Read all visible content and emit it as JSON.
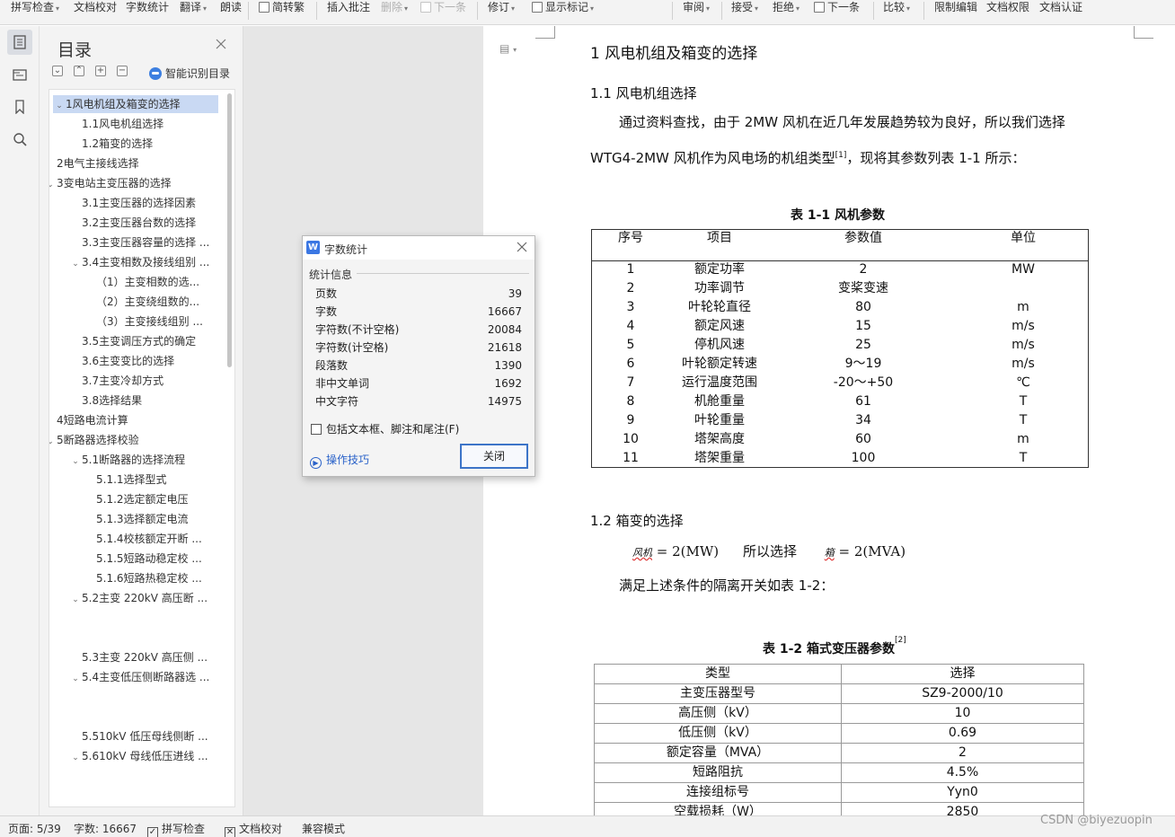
{
  "ribbon": [
    {
      "label": "拼写检查",
      "arrow": true,
      "disabled": false
    },
    {
      "label": "文档校对",
      "arrow": false,
      "disabled": false
    },
    {
      "label": "字数统计",
      "arrow": false,
      "disabled": false
    },
    {
      "label": "翻译",
      "arrow": true,
      "disabled": false
    },
    {
      "label": "朗读",
      "arrow": false,
      "disabled": false
    },
    {
      "label": "简转繁",
      "arrow": false,
      "disabled": false,
      "icon": true
    },
    {
      "label": "插入批注",
      "arrow": false,
      "disabled": false
    },
    {
      "label": "删除",
      "arrow": true,
      "disabled": true
    },
    {
      "label": "下一条",
      "arrow": false,
      "disabled": true,
      "icon": true
    },
    {
      "label": "修订",
      "arrow": true,
      "disabled": false
    },
    {
      "label": "显示标记",
      "arrow": true,
      "disabled": false,
      "icon": true
    },
    {
      "label": "审阅",
      "arrow": true,
      "disabled": false
    },
    {
      "label": "接受",
      "arrow": true,
      "disabled": false
    },
    {
      "label": "拒绝",
      "arrow": true,
      "disabled": false
    },
    {
      "label": "下一条",
      "arrow": false,
      "disabled": false,
      "icon": true
    },
    {
      "label": "比较",
      "arrow": true,
      "disabled": false
    },
    {
      "label": "限制编辑",
      "arrow": false,
      "disabled": false
    },
    {
      "label": "文档权限",
      "arrow": false,
      "disabled": false
    },
    {
      "label": "文档认证",
      "arrow": false,
      "disabled": false
    }
  ],
  "sidebar_icons": [
    "toc-icon",
    "outline-icon",
    "bookmark-icon",
    "search-icon"
  ],
  "toc": {
    "title": "目录",
    "smart_label": "智能识别目录",
    "items": [
      {
        "label": "1风电机组及箱变的选择",
        "indent": 0,
        "chev": "open",
        "selected": true
      },
      {
        "label": "1.1风电机组选择",
        "indent": 1,
        "chev": "",
        "selected": false
      },
      {
        "label": "1.2箱变的选择",
        "indent": 1,
        "chev": "",
        "selected": false
      },
      {
        "label": "2电气主接线选择",
        "indent": 0,
        "chev": "",
        "selected": false
      },
      {
        "label": "3变电站主变压器的选择",
        "indent": 0,
        "chev": "open",
        "selected": false
      },
      {
        "label": "3.1主变压器的选择因素",
        "indent": 1,
        "chev": "",
        "selected": false
      },
      {
        "label": "3.2主变压器台数的选择",
        "indent": 1,
        "chev": "",
        "selected": false
      },
      {
        "label": "3.3主变压器容量的选择 ...",
        "indent": 1,
        "chev": "",
        "selected": false
      },
      {
        "label": "3.4主变相数及接线组别 ...",
        "indent": 1,
        "chev": "open",
        "selected": false
      },
      {
        "label": "（1）主变相数的选...",
        "indent": 2,
        "chev": "",
        "selected": false
      },
      {
        "label": "（2）主变绕组数的...",
        "indent": 2,
        "chev": "",
        "selected": false
      },
      {
        "label": "（3）主变接线组别 ...",
        "indent": 2,
        "chev": "",
        "selected": false
      },
      {
        "label": "3.5主变调压方式的确定",
        "indent": 1,
        "chev": "",
        "selected": false
      },
      {
        "label": "3.6主变变比的选择",
        "indent": 1,
        "chev": "",
        "selected": false
      },
      {
        "label": "3.7主变冷却方式",
        "indent": 1,
        "chev": "",
        "selected": false
      },
      {
        "label": "3.8选择结果",
        "indent": 1,
        "chev": "",
        "selected": false
      },
      {
        "label": "4短路电流计算",
        "indent": 0,
        "chev": "",
        "selected": false
      },
      {
        "label": "5断路器选择校验",
        "indent": 0,
        "chev": "open",
        "selected": false
      },
      {
        "label": "5.1断路器的选择流程",
        "indent": 1,
        "chev": "open",
        "selected": false
      },
      {
        "label": "5.1.1选择型式",
        "indent": 2,
        "chev": "",
        "selected": false
      },
      {
        "label": "5.1.2选定额定电压",
        "indent": 2,
        "chev": "",
        "selected": false
      },
      {
        "label": "5.1.3选择额定电流",
        "indent": 2,
        "chev": "",
        "selected": false
      },
      {
        "label": "5.1.4校核额定开断 ...",
        "indent": 2,
        "chev": "",
        "selected": false
      },
      {
        "label": "5.1.5短路动稳定校 ...",
        "indent": 2,
        "chev": "",
        "selected": false
      },
      {
        "label": "5.1.6短路热稳定校 ...",
        "indent": 2,
        "chev": "",
        "selected": false
      },
      {
        "label": "5.2主变 220kV 高压断 ...",
        "indent": 1,
        "chev": "open",
        "selected": false
      },
      {
        "label": "",
        "indent": 1,
        "chev": "",
        "selected": false
      },
      {
        "label": "",
        "indent": 1,
        "chev": "",
        "selected": false
      },
      {
        "label": "5.3主变 220kV 高压侧 ...",
        "indent": 1,
        "chev": "",
        "selected": false
      },
      {
        "label": "5.4主变低压侧断路器选 ...",
        "indent": 1,
        "chev": "open",
        "selected": false
      },
      {
        "label": "",
        "indent": 1,
        "chev": "",
        "selected": false
      },
      {
        "label": "",
        "indent": 1,
        "chev": "",
        "selected": false
      },
      {
        "label": "5.510kV 低压母线侧断 ...",
        "indent": 1,
        "chev": "",
        "selected": false
      },
      {
        "label": "5.610kV 母线低压进线 ...",
        "indent": 1,
        "chev": "open",
        "selected": false
      }
    ]
  },
  "dialog": {
    "title": "字数统计",
    "group": "统计信息",
    "stats": [
      {
        "label": "页数",
        "value": "39"
      },
      {
        "label": "字数",
        "value": "16667"
      },
      {
        "label": "字符数(不计空格)",
        "value": "20084"
      },
      {
        "label": "字符数(计空格)",
        "value": "21618"
      },
      {
        "label": "段落数",
        "value": "1390"
      },
      {
        "label": "非中文单词",
        "value": "1692"
      },
      {
        "label": "中文字符",
        "value": "14975"
      }
    ],
    "checkbox": "包括文本框、脚注和尾注(F)",
    "tips": "操作技巧",
    "close": "关闭"
  },
  "doc": {
    "h1": "1  风电机组及箱变的选择",
    "h2a": "1.1  风电机组选择",
    "p1": "通过资料查找，由于 2MW 风机在近几年发展趋势较为良好，所以我们选择",
    "p2a": "WTG4-2MW 风机作为风电场的机组类型",
    "p2sup": "[1]",
    "p2b": "，现将其参数列表 1-1 所示：",
    "cap1": "表 1-1  风机参数",
    "t1_header": [
      "序号",
      "项目",
      "参数值",
      "单位"
    ],
    "t1_rows": [
      [
        "1",
        "额定功率",
        "2",
        "MW"
      ],
      [
        "2",
        "功率调节",
        "变桨变速",
        ""
      ],
      [
        "3",
        "叶轮轮直径",
        "80",
        "m"
      ],
      [
        "4",
        "额定风速",
        "15",
        "m/s"
      ],
      [
        "5",
        "停机风速",
        "25",
        "m/s"
      ],
      [
        "6",
        "叶轮额定转速",
        "9～19",
        "m/s"
      ],
      [
        "7",
        "运行温度范围",
        "-20～+50",
        "℃"
      ],
      [
        "8",
        "机舱重量",
        "61",
        "T"
      ],
      [
        "9",
        "叶轮重量",
        "34",
        "T"
      ],
      [
        "10",
        "塔架高度",
        "60",
        "m"
      ],
      [
        "11",
        "塔架重量",
        "100",
        "T"
      ]
    ],
    "h2b": "1.2  箱变的选择",
    "f1_sub": "风机",
    "f1_val": "= 2(MW)",
    "f_mid": "所以选择",
    "f2_sub": "箱",
    "f2_val": "= 2(MVA)",
    "p3": "满足上述条件的隔离开关如表 1-2：",
    "cap2": "表 1-2  箱式变压器参数",
    "cap2sup": "[2]",
    "t2_header": [
      "类型",
      "选择"
    ],
    "t2_rows": [
      [
        "主变压器型号",
        "SZ9-2000/10"
      ],
      [
        "高压侧（kV）",
        "10"
      ],
      [
        "低压侧（kV）",
        "0.69"
      ],
      [
        "额定容量（MVA）",
        "2"
      ],
      [
        "短路阻抗",
        "4.5%"
      ],
      [
        "连接组标号",
        "Yyn0"
      ],
      [
        "空载损耗（W）",
        "2850"
      ]
    ]
  },
  "status": {
    "page": "页面: 5/39",
    "words": "字数: 16667",
    "spell": "拼写检查",
    "proof": "文档校对",
    "compat": "兼容模式"
  },
  "watermark": "CSDN @biyezuopin"
}
